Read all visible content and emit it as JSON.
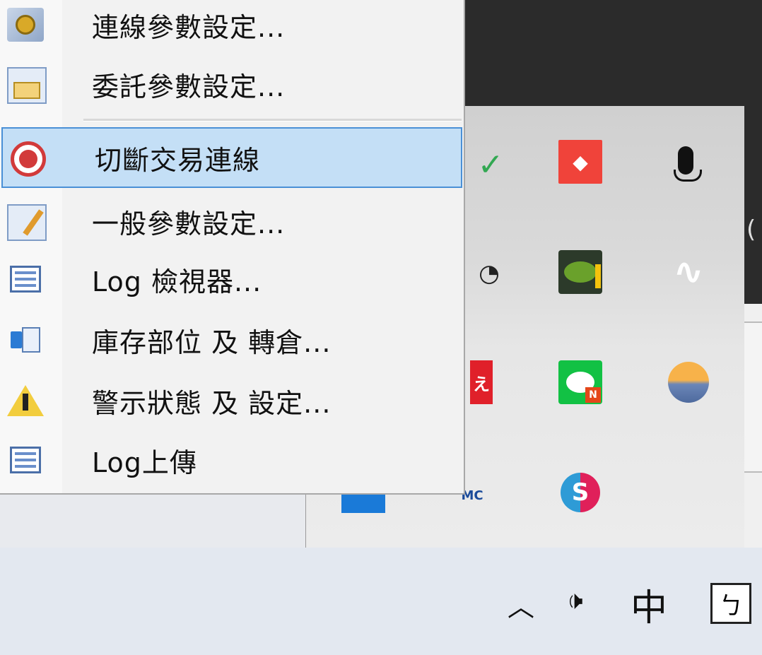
{
  "context_menu": {
    "items": [
      {
        "label": "連線參數設定...",
        "icon": "keys-settings-icon"
      },
      {
        "label": "委託參數設定...",
        "icon": "order-settings-icon"
      },
      {
        "label": "切斷交易連線",
        "icon": "disconnect-icon",
        "highlighted": true
      },
      {
        "label": "一般參數設定...",
        "icon": "general-settings-icon"
      },
      {
        "label": "Log 檢視器...",
        "icon": "log-viewer-icon"
      },
      {
        "label": "庫存部位 及 轉倉...",
        "icon": "inventory-icon"
      },
      {
        "label": "警示狀態 及 設定...",
        "icon": "warning-icon"
      },
      {
        "label": "Log上傳",
        "icon": "log-upload-icon"
      }
    ]
  },
  "tray_flyout": {
    "icons": [
      "anydesk-icon",
      "microphone-icon",
      "nvidia-icon",
      "wave-icon",
      "line-icon",
      "weather-icon",
      "skype-icon",
      "mc-icon"
    ]
  },
  "taskbar": {
    "chevron": "︿",
    "volume": "🕩",
    "ime_label": "中",
    "input_mode": "ㄅ"
  },
  "colors": {
    "highlight": "#c4dff6",
    "highlight_border": "#4a90d6"
  }
}
